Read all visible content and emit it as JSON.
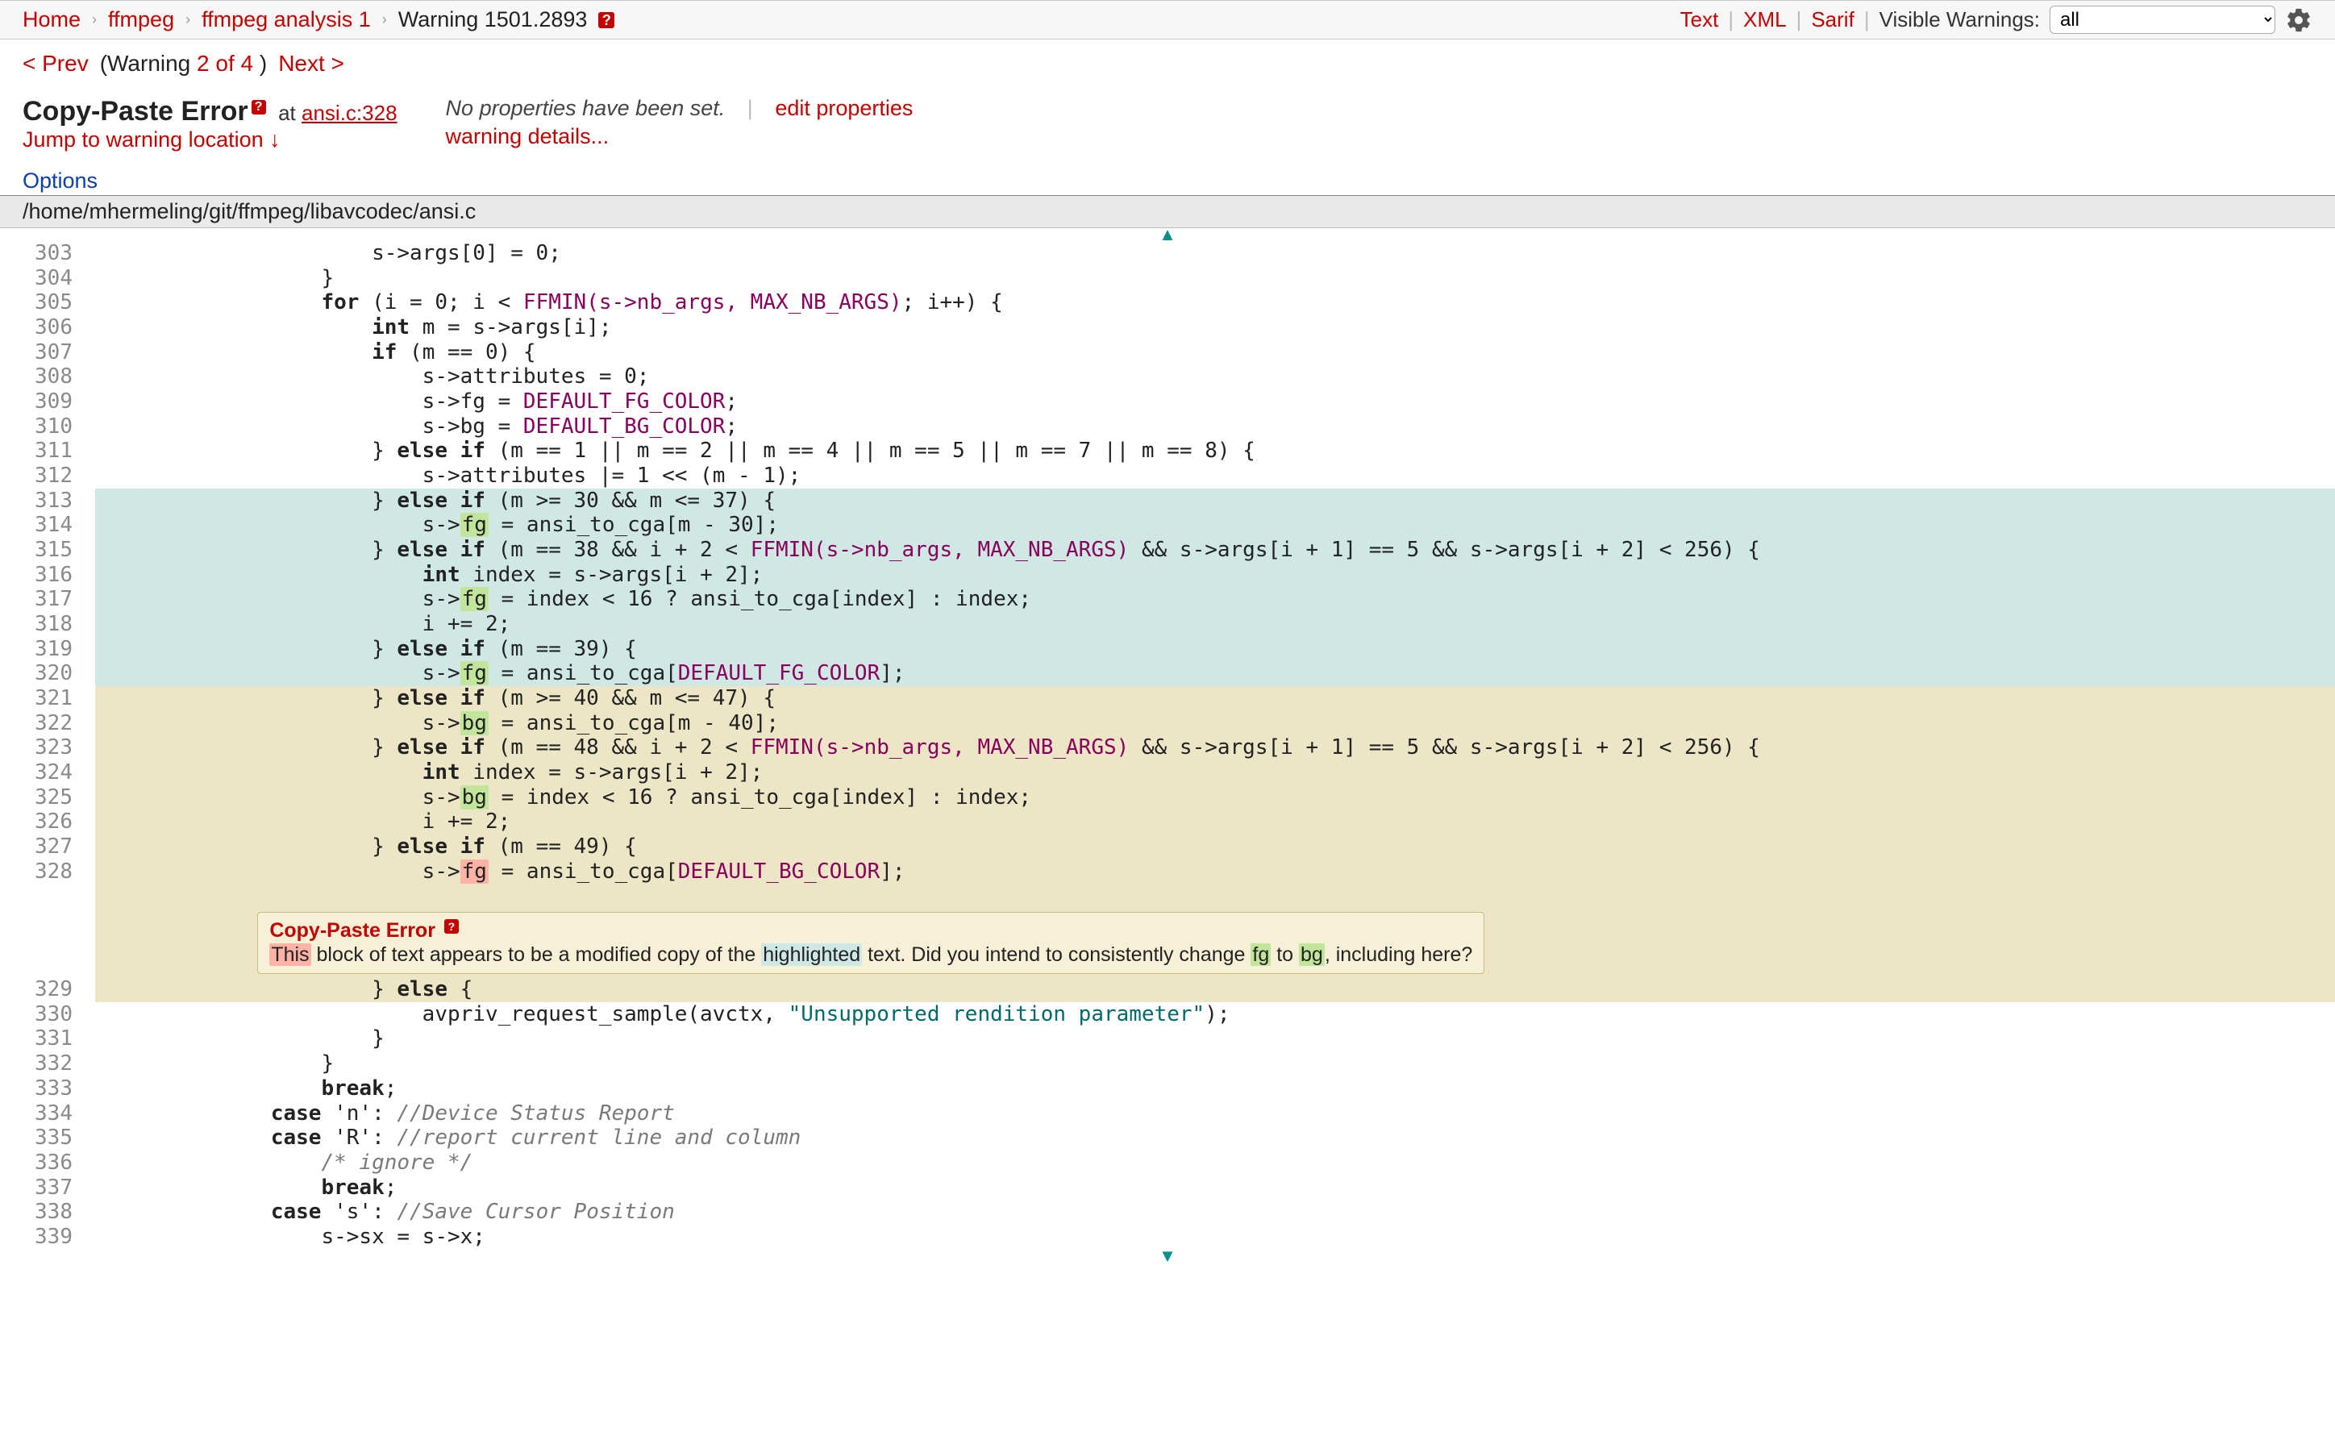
{
  "breadcrumb": {
    "home": "Home",
    "proj": "ffmpeg",
    "analysis": "ffmpeg analysis 1",
    "current": "Warning 1501.2893"
  },
  "top_actions": {
    "text": "Text",
    "xml": "XML",
    "sarif": "Sarif",
    "visible_label": "Visible Warnings:",
    "visible_selected": "all"
  },
  "nav": {
    "prev": "< Prev",
    "counter_prefix": "(Warning ",
    "counter_idx": "2 of 4",
    "counter_suffix": " )",
    "next": "Next >"
  },
  "header": {
    "title": "Copy-Paste Error",
    "at": "at ",
    "file": "ansi.c:328",
    "jump": "Jump to warning location ↓",
    "noprops": "No properties have been set.",
    "edit": "edit properties",
    "details": "warning details..."
  },
  "options": "Options",
  "filepath": "/home/mhermeling/git/ffmpeg/libavcodec/ansi.c",
  "warnbox": {
    "title": "Copy-Paste Error",
    "l1a": "This",
    "l1b": " block of text appears to be a modified copy of the ",
    "l1c": "highlighted",
    "l1d": " text.  Did you intend to consistently change ",
    "l1e": "fg",
    "l1f": " to ",
    "l1g": "bg",
    "l1h": ", including here?"
  },
  "c303a": "                    s->args[0] = 0;",
  "c304a": "                }",
  "c305a": "                ",
  "c305b": "for",
  "c305c": " (i = 0; i < ",
  "c305d": "FFMIN(s->nb_args, MAX_NB_ARGS)",
  "c305e": "; i++) {",
  "c306a": "                    ",
  "c306b": "int",
  "c306c": " m = s->args[i];",
  "c307a": "                    ",
  "c307b": "if",
  "c307c": " (m == 0) {",
  "c308a": "                        s->attributes = 0;",
  "c309a": "                        s->fg = ",
  "c309b": "DEFAULT_FG_COLOR",
  "c309c": ";",
  "c310a": "                        s->bg = ",
  "c310b": "DEFAULT_BG_COLOR",
  "c310c": ";",
  "c311a": "                    } ",
  "c311b": "else if",
  "c311c": " (m == 1 || m == 2 || m == 4 || m == 5 || m == 7 || m == 8) {",
  "c312a": "                        s->attributes |= 1 << (m - 1);",
  "c313a": "                    } ",
  "c313b": "else if",
  "c313c": " (m >= 30 && m <= 37) {",
  "c314a": "                        s->",
  "c314b": "fg",
  "c314c": " = ansi_to_cga[m - 30];",
  "c315a": "                    } ",
  "c315b": "else if",
  "c315c": " (m == 38 && i + 2 < ",
  "c315d": "FFMIN(s->nb_args, MAX_NB_ARGS)",
  "c315e": " && s->args[i + 1] == 5 && s->args[i + 2] < 256) {",
  "c316a": "                        ",
  "c316b": "int",
  "c316c": " index = s->args[i + 2];",
  "c317a": "                        s->",
  "c317b": "fg",
  "c317c": " = index < 16 ? ansi_to_cga[index] : index;",
  "c318a": "                        i += 2;",
  "c319a": "                    } ",
  "c319b": "else if",
  "c319c": " (m == 39) {",
  "c320a": "                        s->",
  "c320b": "fg",
  "c320c": " = ansi_to_cga[",
  "c320d": "DEFAULT_FG_COLOR",
  "c320e": "];",
  "c321a": "                    } ",
  "c321b": "else if",
  "c321c": " (m >= 40 && m <= 47) {",
  "c322a": "                        s->",
  "c322b": "bg",
  "c322c": " = ansi_to_cga[m - 40];",
  "c323a": "                    } ",
  "c323b": "else if",
  "c323c": " (m == 48 && i + 2 < ",
  "c323d": "FFMIN(s->nb_args, MAX_NB_ARGS)",
  "c323e": " && s->args[i + 1] == 5 && s->args[i + 2] < 256) {",
  "c324a": "                        ",
  "c324b": "int",
  "c324c": " index = s->args[i + 2];",
  "c325a": "                        s->",
  "c325b": "bg",
  "c325c": " = index < 16 ? ansi_to_cga[index] : index;",
  "c326a": "                        i += 2;",
  "c327a": "                    } ",
  "c327b": "else if",
  "c327c": " (m == 49) {",
  "c328a": "                        s->",
  "c328b": "fg",
  "c328c": " = ansi_to_cga[",
  "c328d": "DEFAULT_BG_COLOR",
  "c328e": "];",
  "c329a": "                    } ",
  "c329b": "else",
  "c329c": " {",
  "c330a": "                        avpriv_request_sample(avctx, ",
  "c330b": "\"Unsupported rendition parameter\"",
  "c330c": ");",
  "c331a": "                    }",
  "c332a": "                }",
  "c333a": "                ",
  "c333b": "break",
  "c333c": ";",
  "c334a": "            ",
  "c334b": "case",
  "c334c": " 'n': ",
  "c334d": "//Device Status Report",
  "c335a": "            ",
  "c335b": "case",
  "c335c": " 'R': ",
  "c335d": "//report current line and column",
  "c336a": "                ",
  "c336b": "/* ignore */",
  "c337a": "                ",
  "c337b": "break",
  "c337c": ";",
  "c338a": "            ",
  "c338b": "case",
  "c338c": " 's': ",
  "c338d": "//Save Cursor Position",
  "c339a": "                s->sx = s->x;",
  "ln303": "303",
  "ln304": "304",
  "ln305": "305",
  "ln306": "306",
  "ln307": "307",
  "ln308": "308",
  "ln309": "309",
  "ln310": "310",
  "ln311": "311",
  "ln312": "312",
  "ln313": "313",
  "ln314": "314",
  "ln315": "315",
  "ln316": "316",
  "ln317": "317",
  "ln318": "318",
  "ln319": "319",
  "ln320": "320",
  "ln321": "321",
  "ln322": "322",
  "ln323": "323",
  "ln324": "324",
  "ln325": "325",
  "ln326": "326",
  "ln327": "327",
  "ln328": "328",
  "ln329": "329",
  "ln330": "330",
  "ln331": "331",
  "ln332": "332",
  "ln333": "333",
  "ln334": "334",
  "ln335": "335",
  "ln336": "336",
  "ln337": "337",
  "ln338": "338",
  "ln339": "339"
}
